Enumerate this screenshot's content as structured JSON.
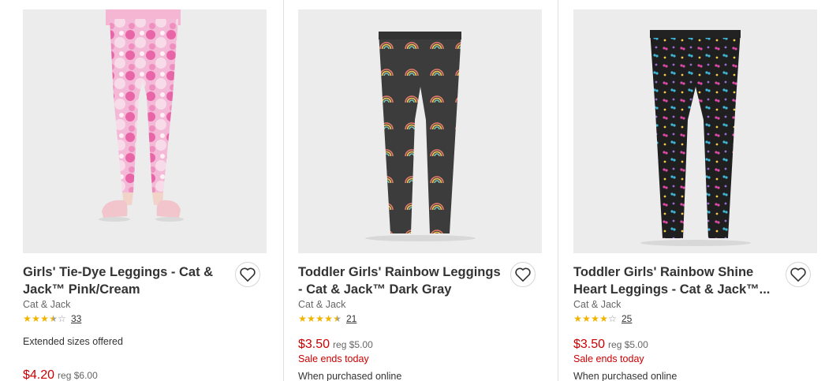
{
  "products": [
    {
      "title": "Girls' Tie-Dye Leggings - Cat & Jack™ Pink/Cream",
      "brand": "Cat & Jack",
      "rating": 3.5,
      "review_count": "33",
      "note": "Extended sizes offered",
      "price": "$4.20",
      "reg_price": "reg $6.00",
      "image_icon": "tie-dye-leggings-photo"
    },
    {
      "title": "Toddler Girls' Rainbow Leggings - Cat & Jack™ Dark Gray",
      "brand": "Cat & Jack",
      "rating": 4.5,
      "review_count": "21",
      "price": "$3.50",
      "reg_price": "reg $5.00",
      "sale_text": "Sale ends today",
      "availability": "When purchased online",
      "image_icon": "rainbow-leggings-photo"
    },
    {
      "title": "Toddler Girls' Rainbow Shine Heart Leggings - Cat & Jack™...",
      "brand": "Cat & Jack",
      "rating": 4.0,
      "review_count": "25",
      "price": "$3.50",
      "reg_price": "reg $5.00",
      "sale_text": "Sale ends today",
      "availability": "When purchased online",
      "image_icon": "heart-leggings-photo"
    }
  ],
  "colors": {
    "price_red": "#cc0000",
    "star_gold": "#f0b400",
    "image_bg": "#ececec"
  },
  "icons": {
    "favorite": "heart-outline-icon",
    "rating": "star-icon"
  }
}
